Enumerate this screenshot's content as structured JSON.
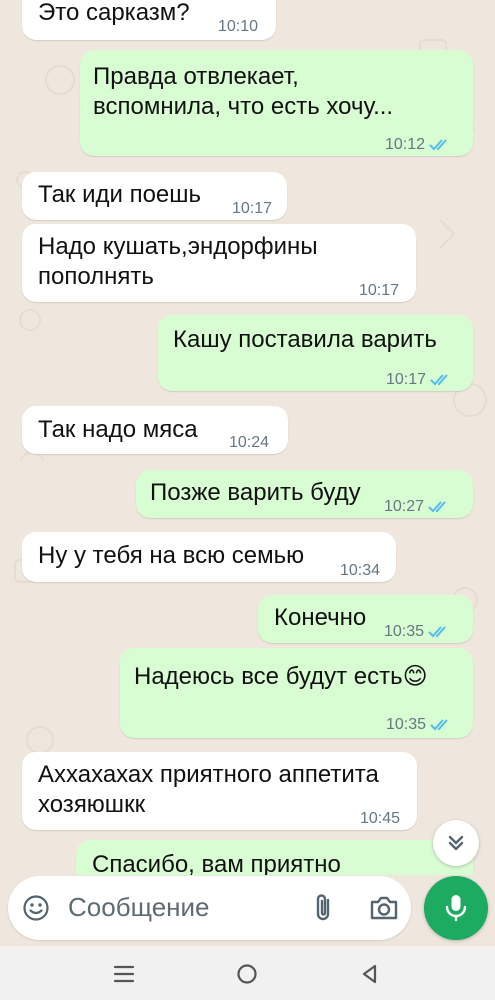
{
  "messages": [
    {
      "dir": "in",
      "text": "Это сарказм?",
      "time": "10:10"
    },
    {
      "dir": "out",
      "text": "Правда отвлекает,\nвспомнила, что есть хочу...",
      "time": "10:12",
      "read": true
    },
    {
      "dir": "in",
      "text": "Так иди поешь",
      "time": "10:17"
    },
    {
      "dir": "in",
      "text": "Надо кушать,эндорфины\nпополнять",
      "time": "10:17"
    },
    {
      "dir": "out",
      "text": "Кашу поставила варить",
      "time": "10:17",
      "read": true
    },
    {
      "dir": "in",
      "text": "Так надо мяса",
      "time": "10:24"
    },
    {
      "dir": "out",
      "text": "Позже варить буду",
      "time": "10:27",
      "read": true
    },
    {
      "dir": "in",
      "text": "Ну у тебя на всю семью",
      "time": "10:34"
    },
    {
      "dir": "out",
      "text": "Конечно",
      "time": "10:35",
      "read": true
    },
    {
      "dir": "out",
      "text": "Надеюсь все будут есть😊",
      "time": "10:35",
      "read": true
    },
    {
      "dir": "in",
      "text": "Аххахахах приятного аппетита\nхозяюшкк",
      "time": "10:45"
    },
    {
      "dir": "out",
      "text": "Спасибо, вам приятно",
      "time": "",
      "read": false
    }
  ],
  "composer": {
    "placeholder": "Сообщение"
  },
  "colors": {
    "outgoing": "#d9fdd3",
    "incoming": "#ffffff",
    "read_ticks": "#53bdeb",
    "accent": "#1daa61",
    "background": "#efe7dd"
  },
  "icons": [
    "emoji-icon",
    "attach-icon",
    "camera-icon",
    "mic-icon",
    "scroll-down-icon",
    "nav-menu-icon",
    "nav-home-icon",
    "nav-back-icon"
  ]
}
